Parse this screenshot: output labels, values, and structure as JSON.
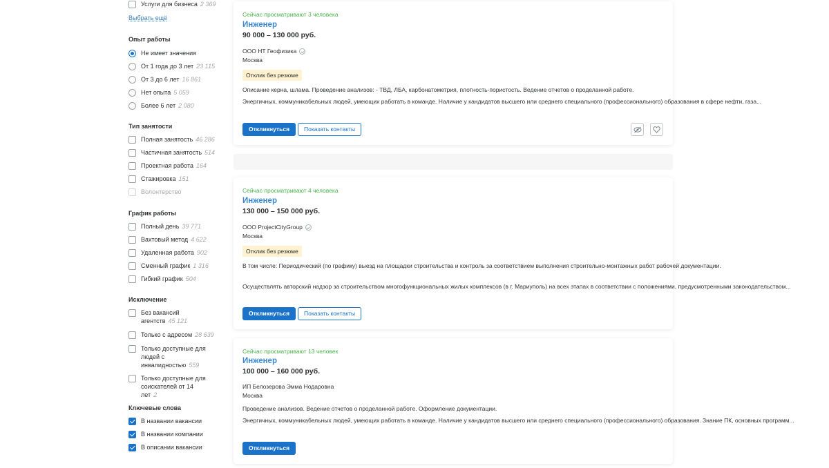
{
  "sidebar": {
    "top_item": {
      "label": "Услуги для бизнеса",
      "count": "2 369"
    },
    "more_link": "Выбрать ещё",
    "experience": {
      "title": "Опыт работы",
      "options": [
        {
          "label": "Не имеет значения",
          "count": ""
        },
        {
          "label": "От 1 года до 3 лет",
          "count": "23 115"
        },
        {
          "label": "От 3 до 6 лет",
          "count": "16 861"
        },
        {
          "label": "Нет опыта",
          "count": "5 059"
        },
        {
          "label": "Более 6 лет",
          "count": "2 080"
        }
      ]
    },
    "employment": {
      "title": "Тип занятости",
      "options": [
        {
          "label": "Полная занятость",
          "count": "46 286"
        },
        {
          "label": "Частичная занятость",
          "count": "514"
        },
        {
          "label": "Проектная работа",
          "count": "164"
        },
        {
          "label": "Стажировка",
          "count": "151"
        },
        {
          "label": "Волонтерство",
          "count": ""
        }
      ]
    },
    "schedule": {
      "title": "График работы",
      "options": [
        {
          "label": "Полный день",
          "count": "39 771"
        },
        {
          "label": "Вахтовый метод",
          "count": "4 622"
        },
        {
          "label": "Удаленная работа",
          "count": "902"
        },
        {
          "label": "Сменный график",
          "count": "1 316"
        },
        {
          "label": "Гибкий график",
          "count": "504"
        }
      ]
    },
    "exclusion": {
      "title": "Исключение",
      "options": [
        {
          "label": "Без вакансий агентств",
          "count": "45 121"
        },
        {
          "label": "Только с адресом",
          "count": "28 639"
        },
        {
          "label": "Только доступные для людей с инвалидностью",
          "count": "559"
        },
        {
          "label": "Только доступные для соискателей от 14 лет",
          "count": "2"
        }
      ]
    },
    "keywords": {
      "title": "Ключевые слова",
      "options": [
        {
          "label": "В названии вакансии"
        },
        {
          "label": "В названии компании"
        },
        {
          "label": "В описании вакансии"
        }
      ]
    }
  },
  "vacancies": [
    {
      "watching": "Сейчас просматривают 3 человека",
      "title": "Инженер",
      "salary": "90 000 – 130 000 руб.",
      "company": "ООО НТ Геофизика",
      "city": "Москва",
      "badge": "Отклик без резюме",
      "desc1": "Описание керна, шлама. Проведение анализов: - ТВД, ЛБА, карбонатометрия, плотность-пористость. Ведение отчетов о проделанной работе.",
      "desc2": "Энергичных, коммуникабельных людей, умеющих работать в команде. Наличие у кандидатов высшего или среднего специального (профессионального) образования в сфере нефти, газа...",
      "apply": "Откликнуться",
      "contacts": "Показать контакты"
    },
    {
      "watching": "Сейчас просматривают 4 человека",
      "title": "Инженер",
      "salary": "130 000 – 150 000 руб.",
      "company": "ООО ProjectCityGroup",
      "city": "Москва",
      "badge": "Отклик без резюме",
      "desc1": "В том числе: Периодический (по графику) выезд на площадки строительства и контроль за соответствием выполнения строительно-монтажных работ рабочей документации.",
      "desc2": "Осуществлять авторский надзор за строительством многофункциональных жилых комплексов (в г. Мариуполь) на всех этапах в соответствии с положениями, предусмотренными законодательством...",
      "apply": "Откликнуться",
      "contacts": "Показать контакты"
    },
    {
      "watching": "Сейчас просматривают 13 человек",
      "title": "Инженер",
      "salary": "100 000 – 160 000 руб.",
      "company": "ИП Белозерова Эмма Нодаровна",
      "city": "Москва",
      "desc1": "Проведение анализов. Ведение отчетов о проделанной работе. Оформление документации.",
      "desc2": "Энергичных, коммуникабельных людей, умеющих работать в команде. Наличие у кандидатов высшего или среднего специального (профессионального) образования. Знание ПК, основных программ...",
      "apply": "Откликнуться"
    }
  ]
}
